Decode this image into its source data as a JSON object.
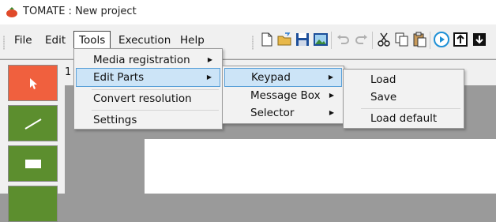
{
  "window": {
    "title": "TOMATE : New project"
  },
  "menubar": {
    "items": [
      {
        "label": "File"
      },
      {
        "label": "Edit"
      },
      {
        "label": "Tools"
      },
      {
        "label": "Execution"
      },
      {
        "label": "Help"
      }
    ]
  },
  "toolbar": {
    "icons": [
      "new-file-icon",
      "open-folder-icon",
      "save-icon",
      "image-icon",
      "undo-icon",
      "redo-icon",
      "cut-icon",
      "copy-icon",
      "paste-icon",
      "play-icon",
      "upload-icon",
      "download-icon"
    ]
  },
  "tab": {
    "label": "1"
  },
  "tools_menu": {
    "items": [
      {
        "label": "Media registration",
        "submenu": true
      },
      {
        "label": "Edit Parts",
        "submenu": true
      },
      {
        "label": "Convert resolution",
        "submenu": false
      },
      {
        "label": "Settings",
        "submenu": false
      }
    ]
  },
  "edit_parts_menu": {
    "items": [
      {
        "label": "Keypad"
      },
      {
        "label": "Message Box"
      },
      {
        "label": "Selector"
      }
    ]
  },
  "keypad_menu": {
    "items": [
      {
        "label": "Load"
      },
      {
        "label": "Save"
      },
      {
        "label": "Load default"
      }
    ]
  },
  "colors": {
    "select_tool": "#f0603e",
    "shape_tool": "#5c8e2e",
    "menu_highlight": "#cce4f7",
    "play_accent": "#1e90d6"
  }
}
